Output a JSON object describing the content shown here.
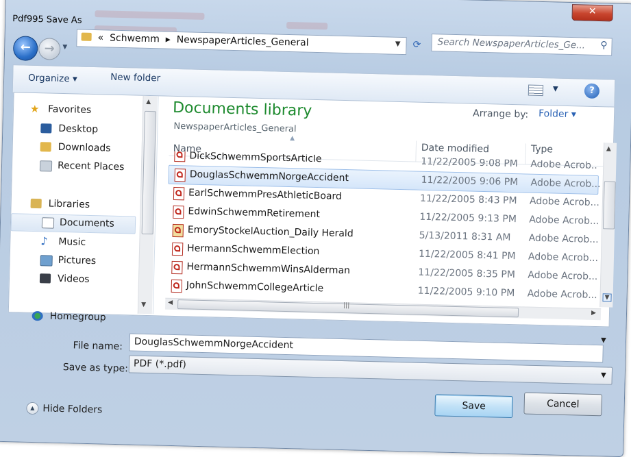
{
  "window": {
    "title": "Pdf995 Save As",
    "close_label": "✕"
  },
  "navigation": {
    "back_icon": "back-arrow-icon",
    "forward_icon": "forward-arrow-icon",
    "breadcrumb": [
      "Schwemm",
      "NewspaperArticles_General"
    ],
    "breadcrumb_prefix": "«",
    "breadcrumb_sep": "▸",
    "search_placeholder": "Search NewspaperArticles_Ge..."
  },
  "toolbar": {
    "organize_label": "Organize",
    "new_folder_label": "New folder"
  },
  "sidebar": {
    "favorites": {
      "label": "Favorites",
      "items": [
        "Desktop",
        "Downloads",
        "Recent Places"
      ]
    },
    "libraries": {
      "label": "Libraries",
      "items": [
        "Documents",
        "Music",
        "Pictures",
        "Videos"
      ],
      "selected": "Documents"
    },
    "homegroup": {
      "label": "Homegroup"
    }
  },
  "library": {
    "title": "Documents library",
    "subtitle": "NewspaperArticles_General",
    "arrange_label": "Arrange by:",
    "arrange_value": "Folder"
  },
  "file_list": {
    "columns": [
      "Name",
      "Date modified",
      "Type"
    ],
    "rows": [
      {
        "name": "DickSchwemmSportsArticle",
        "date": "11/22/2005 9:08 PM",
        "type": "Adobe Acrob..."
      },
      {
        "name": "DouglasSchwemmNorgeAccident",
        "date": "11/22/2005 9:06 PM",
        "type": "Adobe Acrob...",
        "selected": true
      },
      {
        "name": "EarlSchwemmPresAthleticBoard",
        "date": "11/22/2005 8:43 PM",
        "type": "Adobe Acrob..."
      },
      {
        "name": "EdwinSchwemmRetirement",
        "date": "11/22/2005 9:13 PM",
        "type": "Adobe Acrob..."
      },
      {
        "name": "EmoryStockelAuction_Daily Herald",
        "date": "5/13/2011 8:31 AM",
        "type": "Adobe Acrob..."
      },
      {
        "name": "HermannSchwemmElection",
        "date": "11/22/2005 8:41 PM",
        "type": "Adobe Acrob..."
      },
      {
        "name": "HermannSchwemmWinsAlderman",
        "date": "11/22/2005 8:35 PM",
        "type": "Adobe Acrob..."
      },
      {
        "name": "JohnSchwemmCollegeArticle",
        "date": "11/22/2005 9:10 PM",
        "type": "Adobe Acrob..."
      }
    ]
  },
  "form": {
    "file_name_label": "File name:",
    "file_name_value": "DouglasSchwemmNorgeAccident",
    "save_type_label": "Save as type:",
    "save_type_value": "PDF (*.pdf)"
  },
  "footer": {
    "hide_folders_label": "Hide Folders",
    "save_label": "Save",
    "cancel_label": "Cancel"
  }
}
